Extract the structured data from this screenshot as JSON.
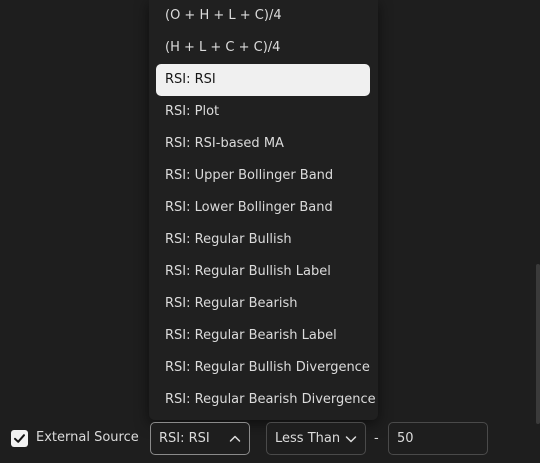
{
  "dropdown": {
    "items": [
      "(O + H + L + C)/4",
      "(H + L + C + C)/4",
      "RSI: RSI",
      "RSI: Plot",
      "RSI: RSI-based MA",
      "RSI: Upper Bollinger Band",
      "RSI: Lower Bollinger Band",
      "RSI: Regular Bullish",
      "RSI: Regular Bullish Label",
      "RSI: Regular Bearish",
      "RSI: Regular Bearish Label",
      "RSI: Regular Bullish Divergence",
      "RSI: Regular Bearish Divergence"
    ],
    "selected_item": "RSI: RSI"
  },
  "external_source": {
    "label": "External Source",
    "checked": true,
    "source_value": "RSI: RSI",
    "condition_value": "Less Than",
    "dash": "-",
    "threshold_value": "50"
  },
  "icons": {
    "checkbox": "checkmark-icon",
    "source_select": "chevron-up-icon",
    "condition_select": "chevron-down-icon"
  },
  "colors": {
    "background": "#1e1e1e",
    "selected_item_bg": "#f0f0f0",
    "text": "#dbdbdb"
  }
}
